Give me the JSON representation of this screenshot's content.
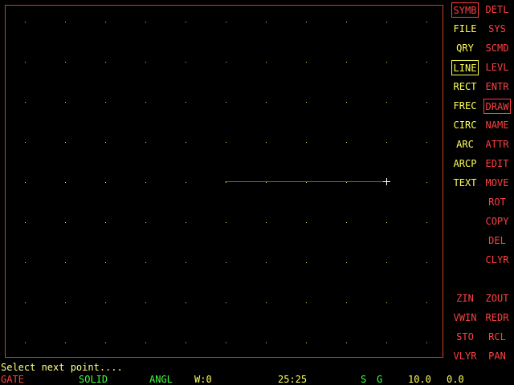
{
  "menu": {
    "left": [
      {
        "id": "symb",
        "label": "SYMB",
        "color": "red",
        "selected": true
      },
      {
        "id": "file",
        "label": "FILE",
        "color": "yellow"
      },
      {
        "id": "qry",
        "label": "QRY",
        "color": "yellow"
      },
      {
        "id": "line",
        "label": "LINE",
        "color": "yellow",
        "selected": true
      },
      {
        "id": "rect",
        "label": "RECT",
        "color": "yellow"
      },
      {
        "id": "frec",
        "label": "FREC",
        "color": "yellow"
      },
      {
        "id": "circ",
        "label": "CIRC",
        "color": "yellow"
      },
      {
        "id": "arc",
        "label": "ARC",
        "color": "yellow"
      },
      {
        "id": "arcp",
        "label": "ARCP",
        "color": "yellow"
      },
      {
        "id": "text",
        "label": "TEXT",
        "color": "yellow"
      }
    ],
    "right": [
      {
        "id": "detl",
        "label": "DETL",
        "color": "red"
      },
      {
        "id": "sys",
        "label": "SYS",
        "color": "red"
      },
      {
        "id": "scmd",
        "label": "SCMD",
        "color": "red"
      },
      {
        "id": "levl",
        "label": "LEVL",
        "color": "red"
      },
      {
        "id": "entr",
        "label": "ENTR",
        "color": "red"
      },
      {
        "id": "draw",
        "label": "DRAW",
        "color": "red",
        "selected": true
      },
      {
        "id": "name",
        "label": "NAME",
        "color": "red"
      },
      {
        "id": "attr",
        "label": "ATTR",
        "color": "red"
      },
      {
        "id": "edit",
        "label": "EDIT",
        "color": "red"
      },
      {
        "id": "move",
        "label": "MOVE",
        "color": "red"
      },
      {
        "id": "rot",
        "label": "ROT",
        "color": "red"
      },
      {
        "id": "copy",
        "label": "COPY",
        "color": "red"
      },
      {
        "id": "del",
        "label": "DEL",
        "color": "red"
      },
      {
        "id": "clyr",
        "label": "CLYR",
        "color": "red"
      }
    ],
    "bottom_left": [
      {
        "id": "zin",
        "label": "ZIN",
        "color": "red"
      },
      {
        "id": "vwin",
        "label": "VWIN",
        "color": "red"
      },
      {
        "id": "sto",
        "label": "STO",
        "color": "red"
      },
      {
        "id": "vlyr",
        "label": "VLYR",
        "color": "red"
      }
    ],
    "bottom_right": [
      {
        "id": "zout",
        "label": "ZOUT",
        "color": "red"
      },
      {
        "id": "redr",
        "label": "REDR",
        "color": "red"
      },
      {
        "id": "rcl",
        "label": "RCL",
        "color": "red"
      },
      {
        "id": "pan",
        "label": "PAN",
        "color": "red"
      }
    ]
  },
  "prompt": "Select next point....",
  "status": {
    "layer": "GATE",
    "line_style": "SOLID",
    "angle_mode": "ANGL",
    "width": "W:0",
    "coords": "25:25",
    "snap": "S",
    "grid": "G",
    "x_value": "10.0",
    "y_value": "0.0"
  },
  "colors": {
    "frame": "#c8421a",
    "grid_dot": "#e0e060",
    "rubber_line": "#ff2020",
    "cursor": "#ffffff",
    "status_red": "#ff4040",
    "status_green": "#40ff40",
    "status_yellow": "#ffff55"
  }
}
